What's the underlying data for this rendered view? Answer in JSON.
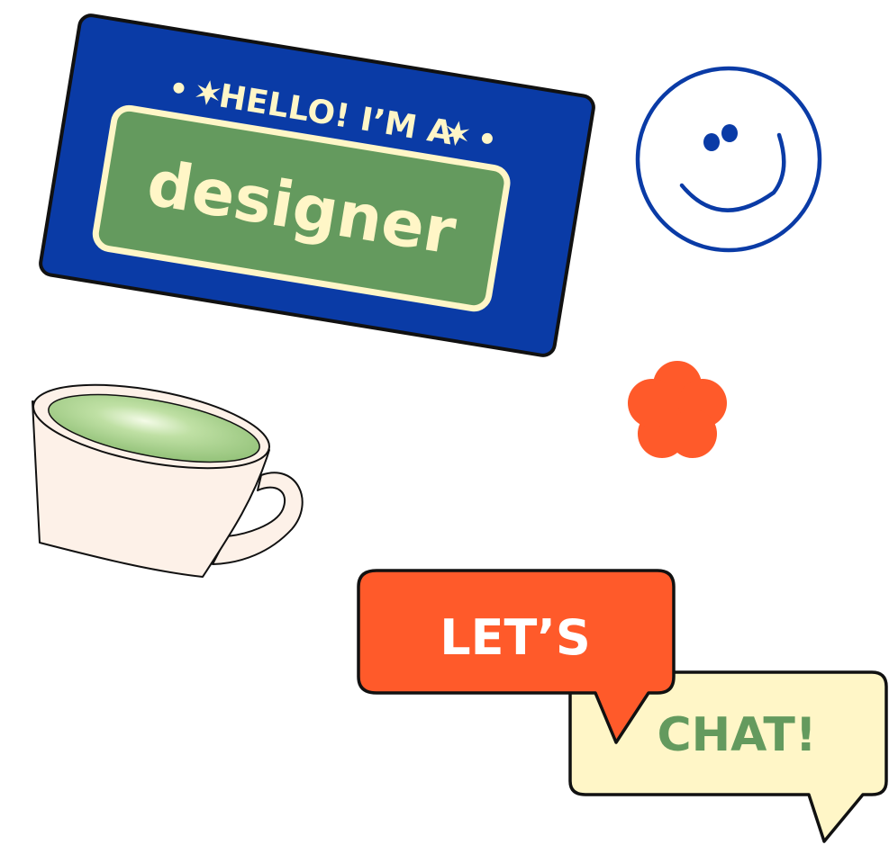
{
  "badge": {
    "tagline": "HELLO! I’M A",
    "role": "designer",
    "colors": {
      "card": "#0A3BA6",
      "plate": "#649A5E",
      "cream": "#FFF6C7"
    }
  },
  "smiley": {
    "icon": "smiley-face-icon",
    "color": "#0A3BA6"
  },
  "flower": {
    "icon": "flower-icon",
    "color": "#FF5A2A"
  },
  "cup": {
    "icon": "matcha-cup-icon",
    "colors": {
      "cup": "#FDF1E8",
      "tea": "#9FCB83"
    }
  },
  "speech": {
    "first": "LET’S",
    "second": "CHAT!",
    "colors": {
      "first_bubble": "#FF5A2A",
      "first_text": "#FFFFFF",
      "second_bubble": "#FFF6C7",
      "second_text": "#649A5E"
    }
  }
}
